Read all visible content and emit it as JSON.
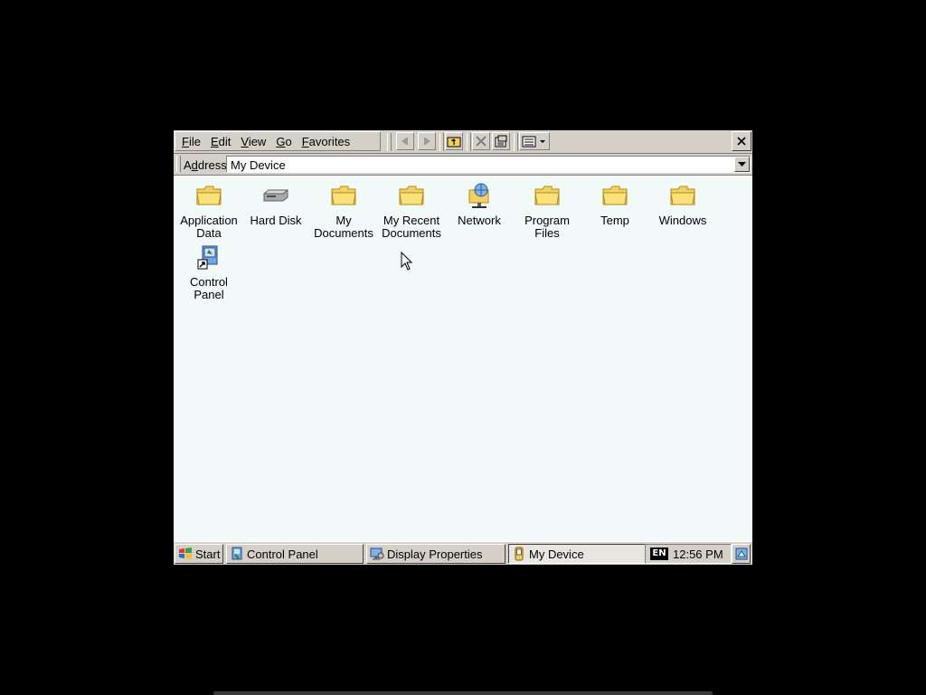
{
  "window": {
    "menus": [
      {
        "label": "File",
        "access_key": "F",
        "rest": "ile"
      },
      {
        "label": "Edit",
        "access_key": "E",
        "rest": "dit"
      },
      {
        "label": "View",
        "access_key": "V",
        "rest": "iew"
      },
      {
        "label": "Go",
        "access_key": "G",
        "rest": "o"
      },
      {
        "label": "Favorites",
        "access_key": "F",
        "rest": "avorites"
      }
    ],
    "toolbar_icons": [
      "back-arrow-icon",
      "forward-arrow-icon",
      "up-folder-icon",
      "delete-icon",
      "properties-icon",
      "views-icon"
    ],
    "close_icon": "close-icon"
  },
  "address": {
    "label_pre": "A",
    "label_key": "d",
    "label_post": "dress",
    "value": "My Device"
  },
  "items": [
    {
      "label": "Application\nData",
      "icon": "folder-icon"
    },
    {
      "label": "Hard Disk",
      "icon": "hard-disk-icon"
    },
    {
      "label": "My\nDocuments",
      "icon": "folder-icon"
    },
    {
      "label": "My Recent\nDocuments",
      "icon": "folder-icon"
    },
    {
      "label": "Network",
      "icon": "network-icon"
    },
    {
      "label": "Program Files",
      "icon": "folder-icon"
    },
    {
      "label": "Temp",
      "icon": "folder-icon"
    },
    {
      "label": "Windows",
      "icon": "folder-icon"
    },
    {
      "label": "Control\nPanel",
      "icon": "control-panel-shortcut-icon"
    }
  ],
  "taskbar": {
    "start_label": "Start",
    "tasks": [
      {
        "label": "Control Panel",
        "icon": "control-panel-icon",
        "active": false
      },
      {
        "label": "Display Properties",
        "icon": "display-icon",
        "active": false
      },
      {
        "label": "My Device",
        "icon": "device-icon",
        "active": true
      }
    ],
    "language": "EN",
    "clock": "12:56 PM",
    "show_desktop_icon": "desktop-icon"
  },
  "colors": {
    "content_bg": "#f2f9f9",
    "chrome": "#d4d0c8",
    "folder": "#f5d35a"
  }
}
